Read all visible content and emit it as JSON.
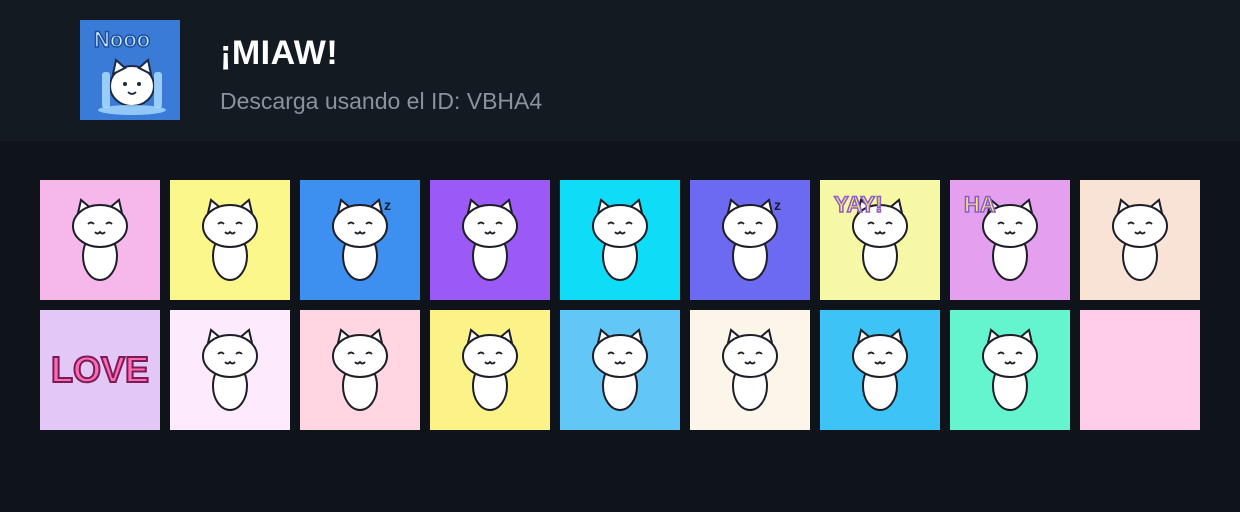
{
  "pack": {
    "title": "¡MIAW!",
    "subtitle": "Descarga usando el ID: VBHA4",
    "icon_text": "Nooo",
    "icon_name": "crying-cat-icon"
  },
  "stickers": [
    {
      "name": "sticker-cat-box-heart",
      "bg": "#f6b8ea",
      "icon": "cat-box-heart-icon",
      "label": ""
    },
    {
      "name": "sticker-cat-sparkle-dance",
      "bg": "#fbf78a",
      "icon": "cat-sparkle-icon",
      "label": ""
    },
    {
      "name": "sticker-cat-sleeping-cap",
      "bg": "#3d8ff0",
      "icon": "cat-sleep-icon",
      "label": "z"
    },
    {
      "name": "sticker-cat-standing",
      "bg": "#9b59f6",
      "icon": "cat-standing-icon",
      "label": ""
    },
    {
      "name": "sticker-cat-bed",
      "bg": "#0fdcf6",
      "icon": "cat-bed-icon",
      "label": ""
    },
    {
      "name": "sticker-cat-moon",
      "bg": "#6b6af1",
      "icon": "cat-moon-icon",
      "label": "z"
    },
    {
      "name": "sticker-cat-yay",
      "bg": "#f6f8a6",
      "icon": "cat-yay-icon",
      "label": "YAY!"
    },
    {
      "name": "sticker-cat-ha",
      "bg": "#e4a0ef",
      "icon": "cat-laugh-icon",
      "label": "HA"
    },
    {
      "name": "sticker-cat-cake",
      "bg": "#f9e3d6",
      "icon": "cat-cake-icon",
      "label": ""
    },
    {
      "name": "sticker-love",
      "bg": "#e2c7f7",
      "icon": "love-text-icon",
      "label": "LOVE"
    },
    {
      "name": "sticker-cat-giggle",
      "bg": "#fdeafd",
      "icon": "cat-giggle-icon",
      "label": ""
    },
    {
      "name": "sticker-cat-phone-heart",
      "bg": "#ffd6e1",
      "icon": "cat-phone-icon",
      "label": ""
    },
    {
      "name": "sticker-cat-sitting",
      "bg": "#fbf288",
      "icon": "cat-sitting-icon",
      "label": ""
    },
    {
      "name": "sticker-cat-pillow",
      "bg": "#62c7f7",
      "icon": "cat-pillow-icon",
      "label": ""
    },
    {
      "name": "sticker-cat-grumpy",
      "bg": "#fcf6ea",
      "icon": "cat-grumpy-icon",
      "label": ""
    },
    {
      "name": "sticker-cat-maracas",
      "bg": "#3ec3f7",
      "icon": "cat-maracas-icon",
      "label": ""
    },
    {
      "name": "sticker-cat-mint",
      "bg": "#64f5cf",
      "icon": "cat-mint-icon",
      "label": ""
    },
    {
      "name": "sticker-empty-pink",
      "bg": "#fdcde9",
      "icon": "blank-icon",
      "label": ""
    }
  ]
}
